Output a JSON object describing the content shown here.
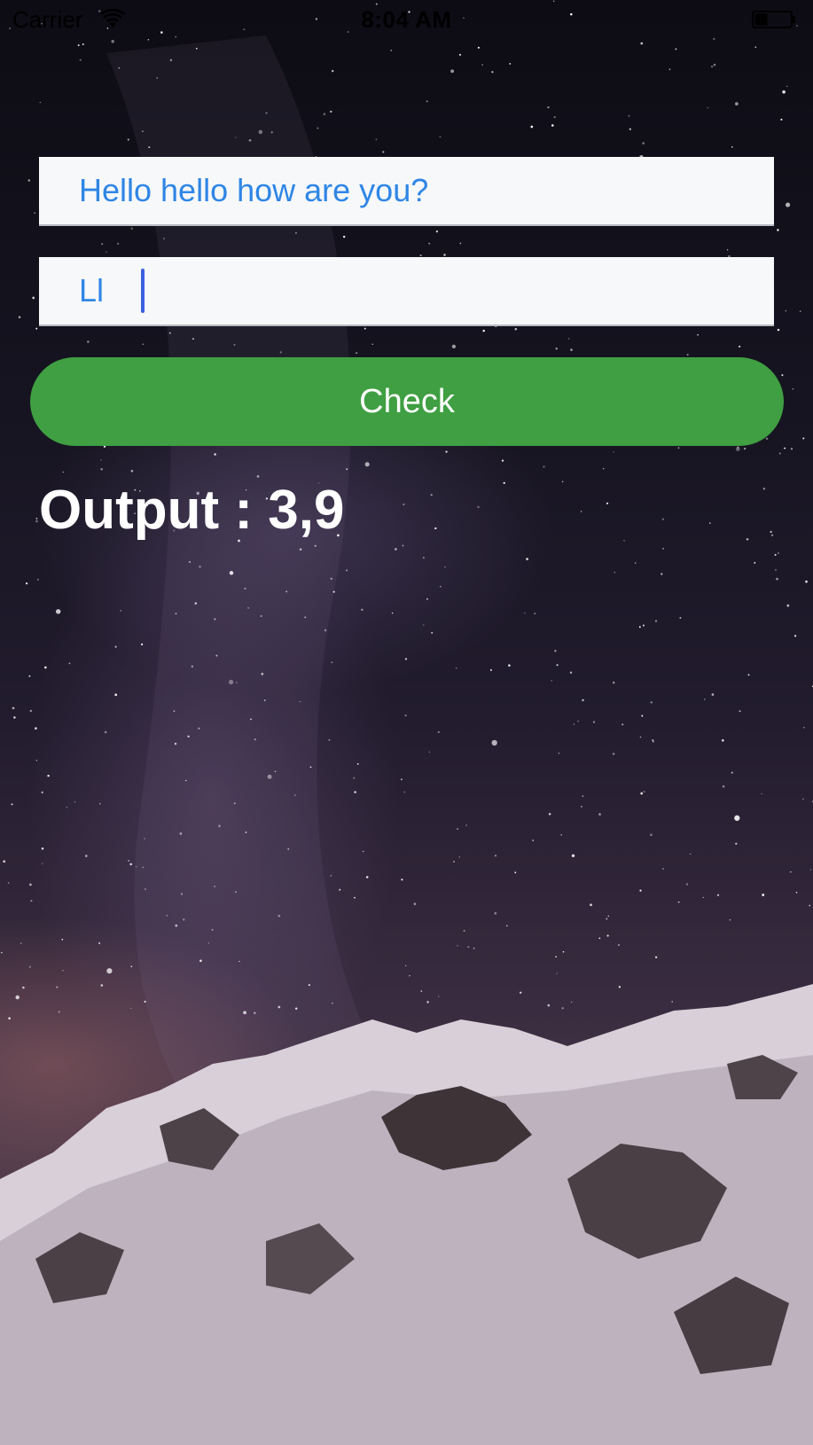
{
  "status_bar": {
    "carrier": "Carrier",
    "time": "8:04 AM",
    "wifi_icon": "wifi-icon",
    "battery_icon": "battery-icon"
  },
  "form": {
    "input_one_value": "Hello hello how are you?",
    "input_two_value": "Ll",
    "check_label": "Check",
    "check_color": "#3f9f42",
    "text_color": "#2f86e6"
  },
  "output": {
    "text": "Output : 3,9"
  }
}
